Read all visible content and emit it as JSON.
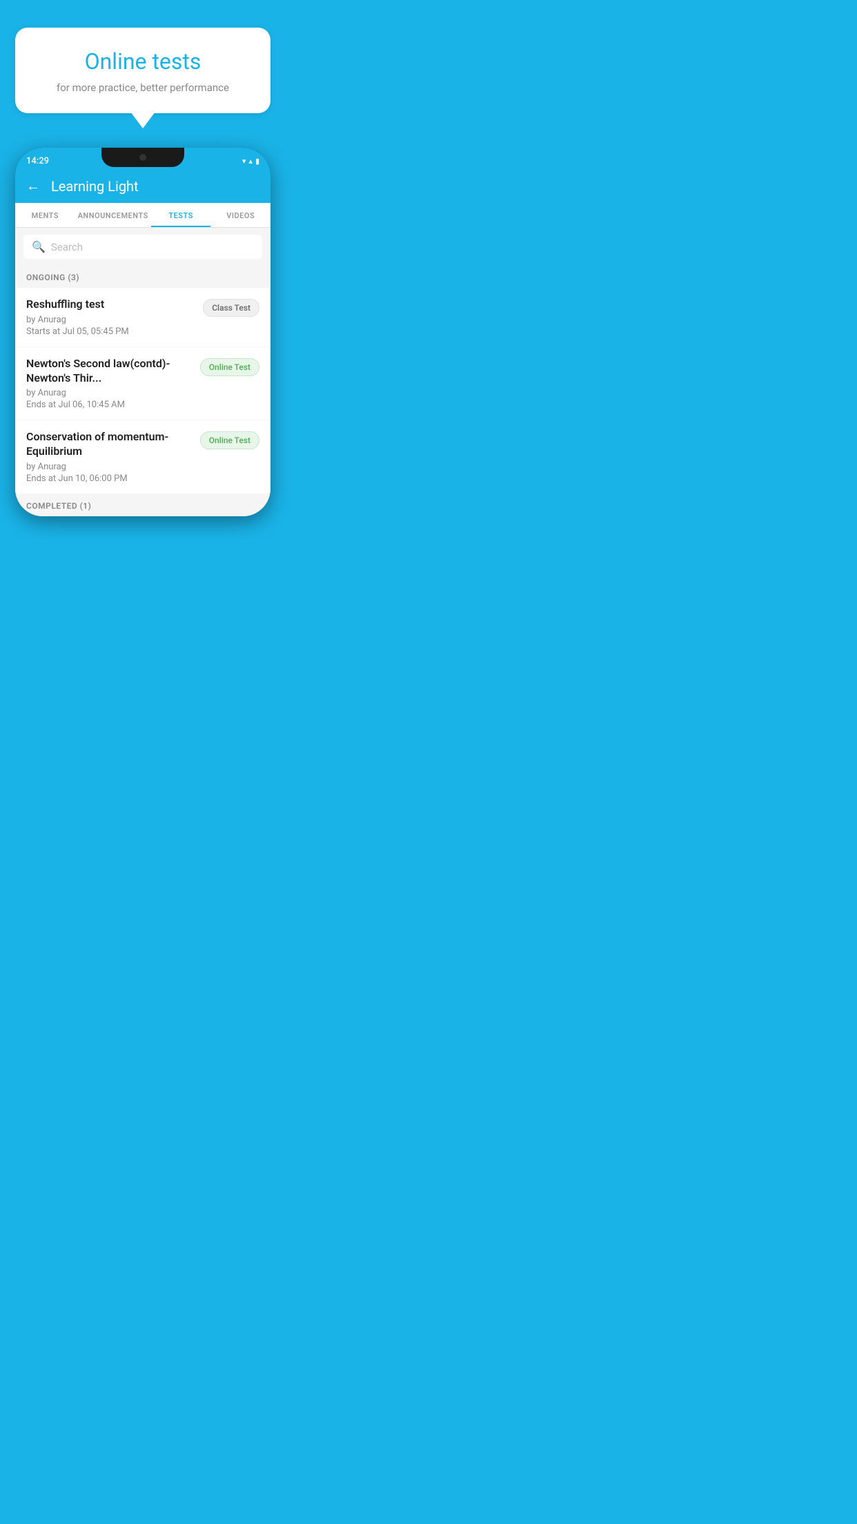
{
  "background": {
    "color": "#1ab3e8"
  },
  "speech_bubble": {
    "title": "Online tests",
    "subtitle": "for more practice, better performance"
  },
  "phone": {
    "status_bar": {
      "time": "14:29",
      "wifi_icon": "▼",
      "signal_icon": "▲",
      "battery_icon": "▮"
    },
    "app_header": {
      "back_label": "←",
      "title": "Learning Light"
    },
    "tabs": [
      {
        "label": "MENTS",
        "active": false
      },
      {
        "label": "ANNOUNCEMENTS",
        "active": false
      },
      {
        "label": "TESTS",
        "active": true
      },
      {
        "label": "VIDEOS",
        "active": false
      }
    ],
    "search": {
      "placeholder": "Search"
    },
    "ongoing_section": {
      "header": "ONGOING (3)",
      "tests": [
        {
          "title": "Reshuffling test",
          "author": "by Anurag",
          "date": "Starts at  Jul 05, 05:45 PM",
          "badge": "Class Test",
          "badge_type": "class"
        },
        {
          "title": "Newton's Second law(contd)-Newton's Thir...",
          "author": "by Anurag",
          "date": "Ends at  Jul 06, 10:45 AM",
          "badge": "Online Test",
          "badge_type": "online"
        },
        {
          "title": "Conservation of momentum-Equilibrium",
          "author": "by Anurag",
          "date": "Ends at  Jun 10, 06:00 PM",
          "badge": "Online Test",
          "badge_type": "online"
        }
      ]
    },
    "completed_section": {
      "header": "COMPLETED (1)"
    }
  }
}
